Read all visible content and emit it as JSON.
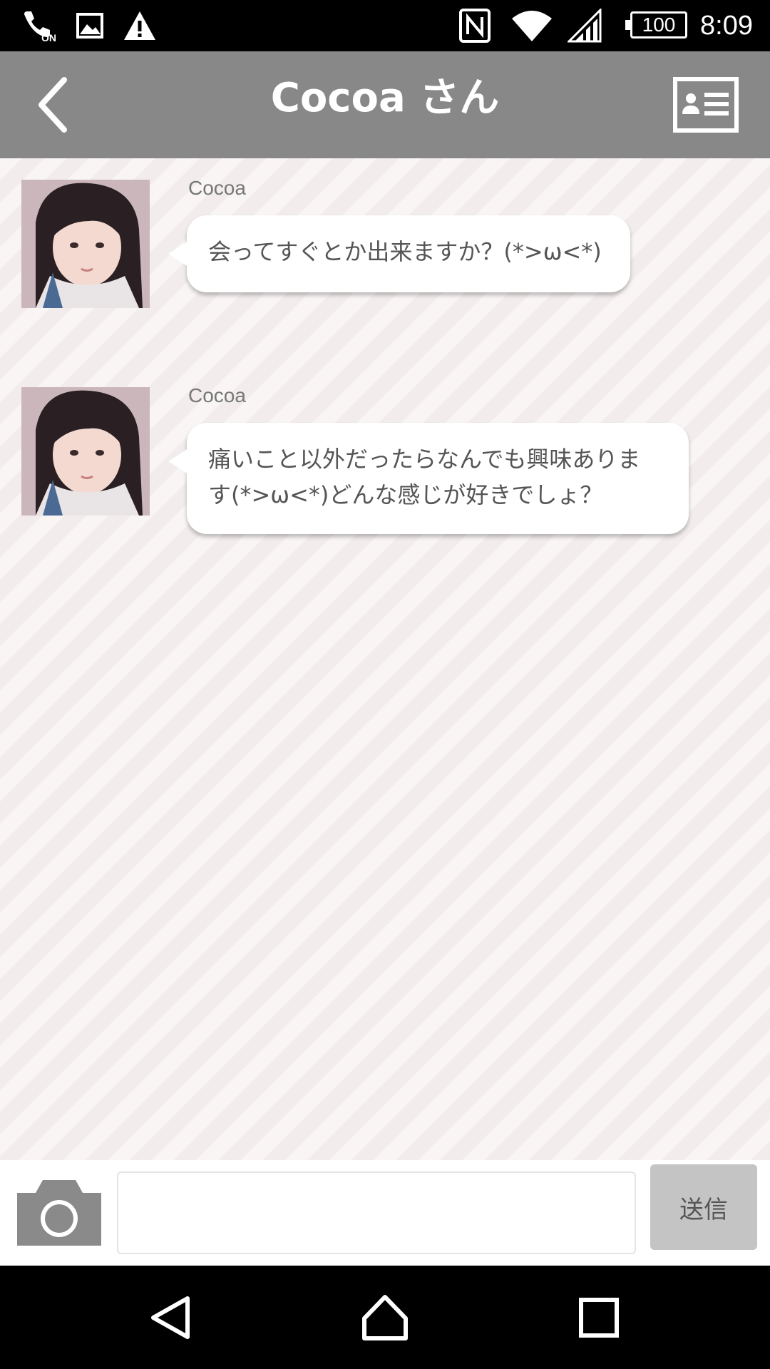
{
  "status_bar": {
    "time": "8:09",
    "battery": "100",
    "left_icons": [
      "nfc-on-icon",
      "image-icon",
      "warning-icon"
    ],
    "right_icons": [
      "nfc-icon",
      "wifi-icon",
      "signal-icon",
      "battery-icon"
    ]
  },
  "header": {
    "title": "Cocoa さん",
    "back_icon": "chevron-left-icon",
    "profile_icon": "profile-card-icon",
    "background": "#888888"
  },
  "messages": [
    {
      "sender": "Cocoa",
      "text": "会ってすぐとか出来ますか？(*>ω<*)"
    },
    {
      "sender": "Cocoa",
      "text_line1": "痛いこと以外だったらなんでも興味ありま",
      "text_line2": "す(*>ω<*)どんな感じが好きでしょ？"
    }
  ],
  "input_bar": {
    "camera_icon": "camera-icon",
    "message_value": "",
    "send_label": "送信"
  },
  "nav_bar": {
    "icons": [
      "back-triangle-icon",
      "home-icon",
      "recents-icon"
    ]
  }
}
